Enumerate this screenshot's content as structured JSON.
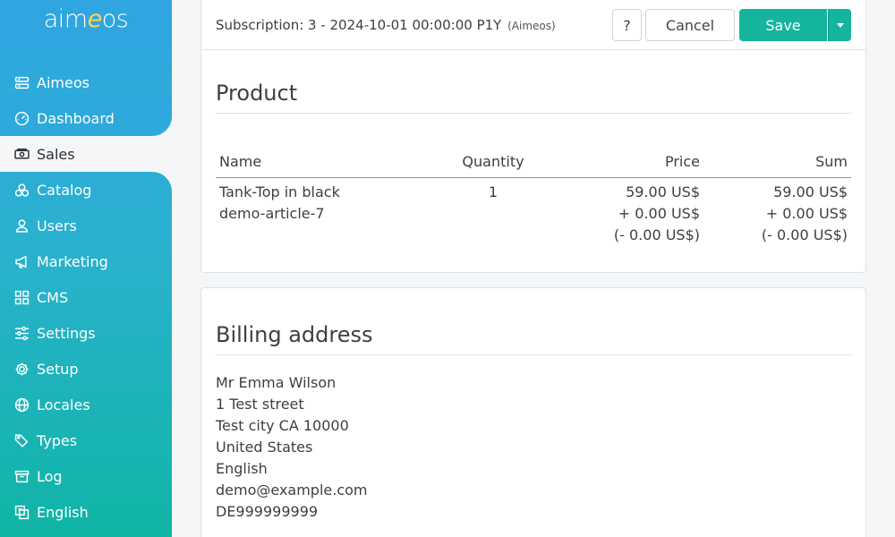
{
  "app": {
    "logo_prefix": "aim",
    "logo_e": "e",
    "logo_suffix": "os"
  },
  "sidebar": {
    "items": [
      {
        "label": "Aimeos",
        "icon": "server-icon"
      },
      {
        "label": "Dashboard",
        "icon": "speedometer-icon"
      },
      {
        "label": "Sales",
        "icon": "cash-icon",
        "active": true
      },
      {
        "label": "Catalog",
        "icon": "boxes-icon"
      },
      {
        "label": "Users",
        "icon": "person-icon"
      },
      {
        "label": "Marketing",
        "icon": "megaphone-icon"
      },
      {
        "label": "CMS",
        "icon": "grid-icon"
      },
      {
        "label": "Settings",
        "icon": "sliders-icon"
      },
      {
        "label": "Setup",
        "icon": "gear-icon"
      },
      {
        "label": "Locales",
        "icon": "globe-icon"
      },
      {
        "label": "Types",
        "icon": "tags-icon"
      },
      {
        "label": "Log",
        "icon": "archive-icon"
      },
      {
        "label": "English",
        "icon": "translate-icon"
      }
    ]
  },
  "header": {
    "title": "Subscription: 3 - 2024-10-01 00:00:00 P1Y",
    "site": "(Aimeos)",
    "help_label": "?",
    "cancel_label": "Cancel",
    "save_label": "Save"
  },
  "product": {
    "title": "Product",
    "columns": {
      "name": "Name",
      "quantity": "Quantity",
      "price": "Price",
      "sum": "Sum"
    },
    "rows": [
      {
        "name": "Tank-Top in black",
        "code": "demo-article-7",
        "quantity": "1",
        "price": "59.00 US$",
        "price_costs": "+ 0.00 US$",
        "price_rebate": "(- 0.00 US$)",
        "sum": "59.00 US$",
        "sum_costs": "+ 0.00 US$",
        "sum_rebate": "(- 0.00 US$)"
      }
    ]
  },
  "billing": {
    "title": "Billing address",
    "lines": [
      "Mr Emma Wilson",
      "1 Test street",
      "Test city CA 10000",
      "United States",
      "English",
      "demo@example.com",
      "DE999999999"
    ]
  },
  "colors": {
    "accent": "#15b49c",
    "sidebar_top": "#30a5e2",
    "sidebar_bottom": "#10b5a5"
  }
}
